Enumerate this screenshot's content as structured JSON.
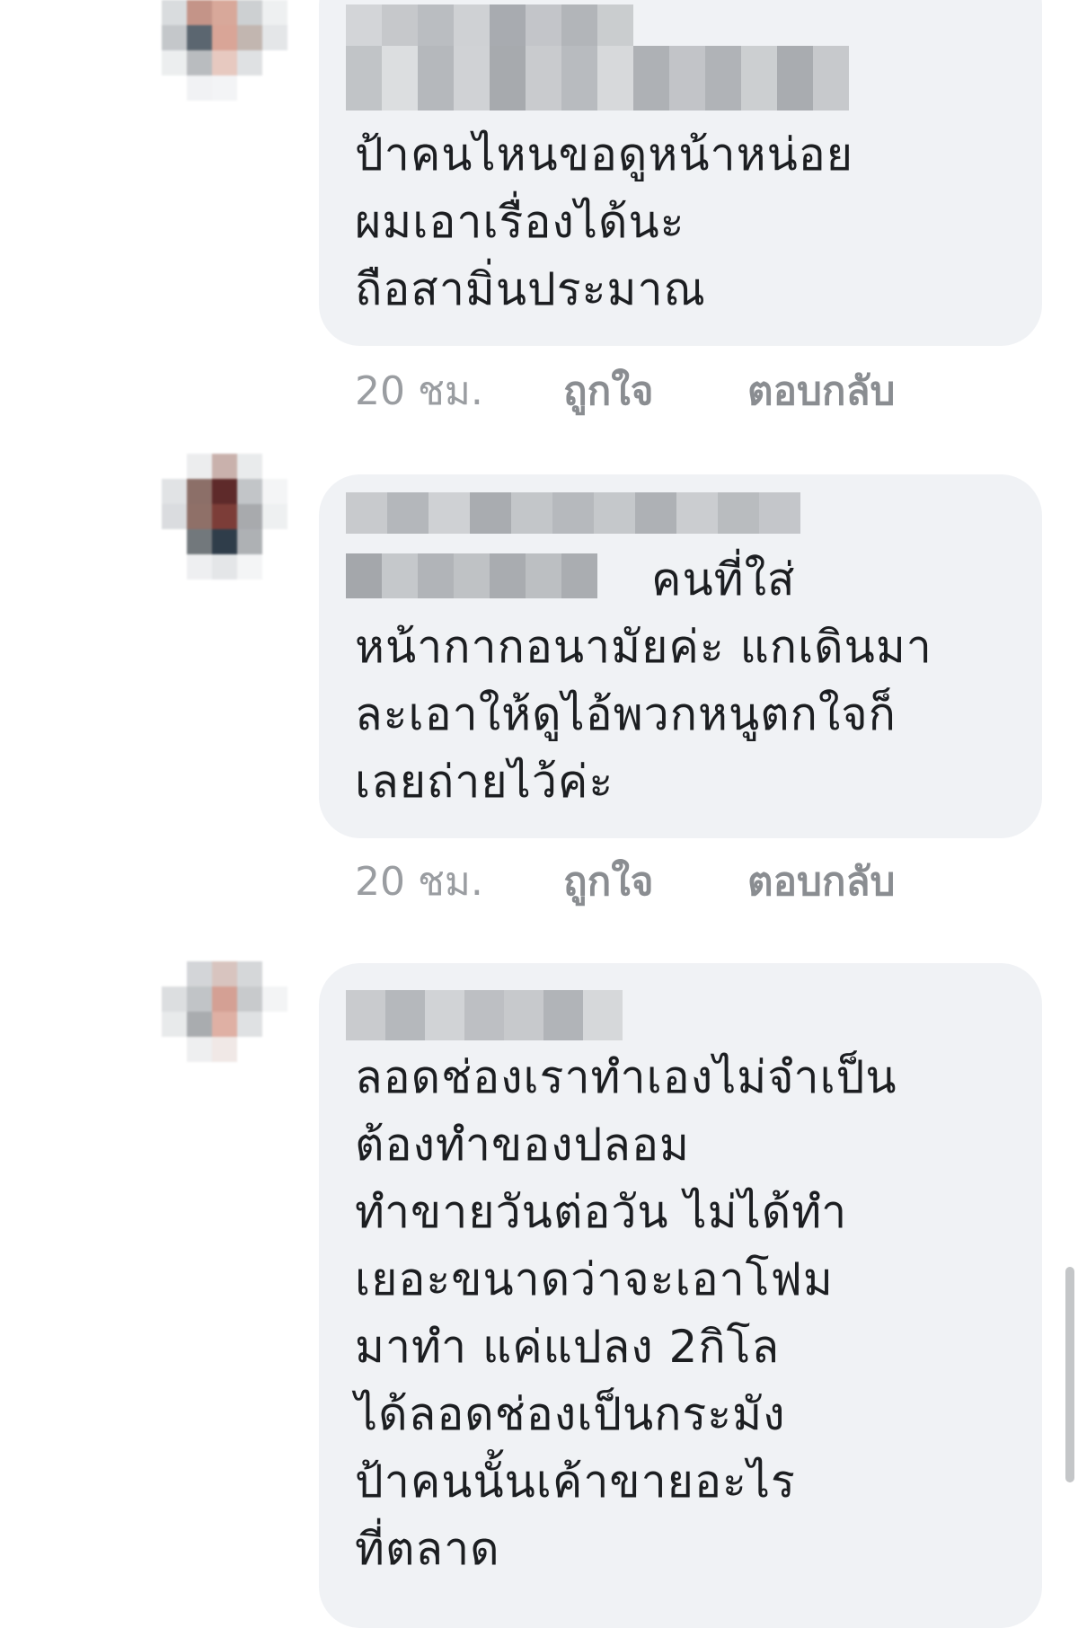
{
  "comments": [
    {
      "text": "ป้าคนไหนขอดูหน้าหน่อย\nผมเอาเรื่องได้นะ\nถือสามิ่นประมาณ",
      "time": "20 ชม.",
      "like": "ถูกใจ",
      "reply": "ตอบกลับ"
    },
    {
      "text": "คนที่ใส่\nหน้ากากอนามัยค่ะ แกเดินมา\nละเอาให้ดูไอ้พวกหนูตกใจก็\nเลยถ่ายไว้ค่ะ",
      "time": "20 ชม.",
      "like": "ถูกใจ",
      "reply": "ตอบกลับ"
    },
    {
      "text": "ลอดช่องเราทำเองไม่จำเป็น\nต้องทำของปลอม\nทำขายวันต่อวัน ไม่ได้ทำ\nเยอะขนาดว่าจะเอาโฟม\nมาทำ แค่แปลง 2กิโล\nได้ลอดช่องเป็นกระมัง\nป้าคนนั้นเค้าขายอะไร\nที่ตลาด"
    }
  ],
  "colors": {
    "bubble": "#f0f2f5",
    "text": "#1c1e21",
    "meta": "#8a8d91"
  },
  "icons": [
    "avatar-blurred",
    "name-blurred"
  ]
}
